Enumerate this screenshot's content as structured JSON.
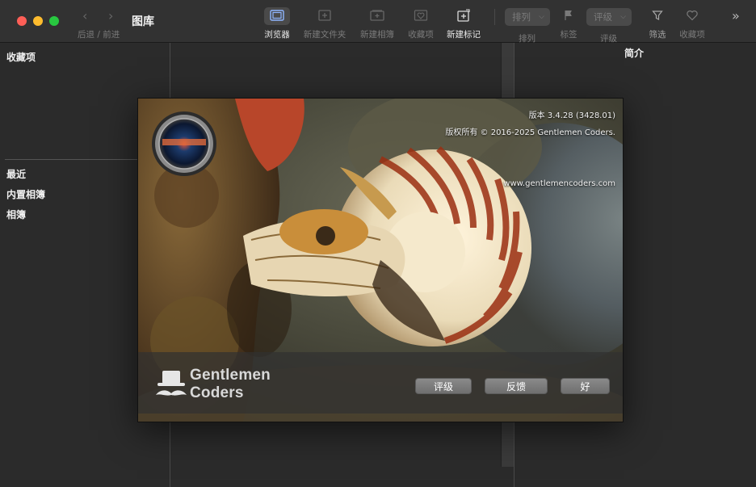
{
  "window": {
    "title": "图库",
    "nav_label": "后退 / 前进"
  },
  "toolbar": {
    "browser": "浏览器",
    "new_folder": "新建文件夹",
    "new_album": "新建相簿",
    "favorites": "收藏项",
    "new_tag": "新建标记",
    "sort_popup": "排列",
    "sort": "排列",
    "tags": "标签",
    "rating_popup": "评级",
    "rating": "评级",
    "filter": "筛选",
    "favorites2": "收藏项"
  },
  "sidebar": {
    "favorites_header": "收藏项",
    "items": [
      "最近",
      "内置相簿",
      "相簿"
    ]
  },
  "info_panel": {
    "title": "简介"
  },
  "about": {
    "version": "版本 3.4.28 (3428.01)",
    "copyright": "版权所有 © 2016-2025 Gentlemen Coders.",
    "website": "www.gentlemencoders.com",
    "company_line1": "Gentlemen",
    "company_line2": "Coders",
    "buttons": {
      "rate": "评级",
      "feedback": "反馈",
      "ok": "好"
    }
  },
  "colors": {
    "window_bg": "#2b2b2b",
    "toolbar_bg": "#323232",
    "close": "#fe5f57",
    "minimize": "#febc2e",
    "zoom": "#28c840"
  },
  "icons": [
    "back-arrow-icon",
    "forward-arrow-icon",
    "browser-icon",
    "new-folder-icon",
    "new-album-icon",
    "favorite-heart-icon",
    "new-tag-icon",
    "flag-icon",
    "filter-funnel-icon",
    "toolbar-overflow-icon",
    "app-lens-icon",
    "hat-mustache-logo"
  ]
}
